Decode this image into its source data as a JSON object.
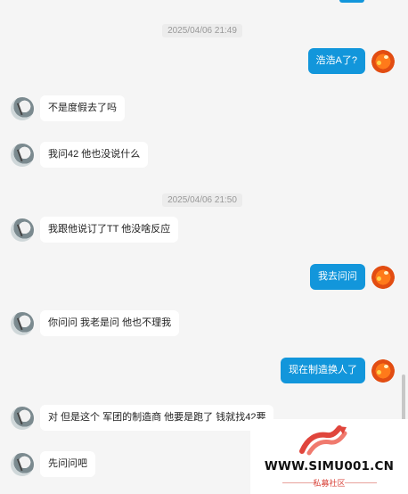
{
  "timestamps": [
    "2025/04/06 21:49",
    "2025/04/06 21:50"
  ],
  "messages": [
    {
      "side": "right",
      "text": "浩浩A了?"
    },
    {
      "side": "left",
      "text": "不是度假去了吗"
    },
    {
      "side": "left",
      "text": "我问42 他也没说什么"
    },
    {
      "side": "left",
      "text": "我跟他说订了TT 他没啥反应"
    },
    {
      "side": "right",
      "text": "我去问问"
    },
    {
      "side": "left",
      "text": "你问问 我老是问 他也不理我"
    },
    {
      "side": "right",
      "text": "现在制造换人了"
    },
    {
      "side": "left",
      "text": "对 但是这个 军团的制造商 他要是跑了 钱就找42要"
    },
    {
      "side": "left",
      "text": "先问问吧"
    }
  ],
  "avatars": {
    "left": "cat-avatar",
    "right": "orange-avatar"
  },
  "colors": {
    "background": "#f5f5f5",
    "own_bubble": "#1296db",
    "other_bubble": "#ffffff"
  },
  "watermark": {
    "url": "WWW.SIMU001.CN",
    "subtitle": "私募社区"
  }
}
